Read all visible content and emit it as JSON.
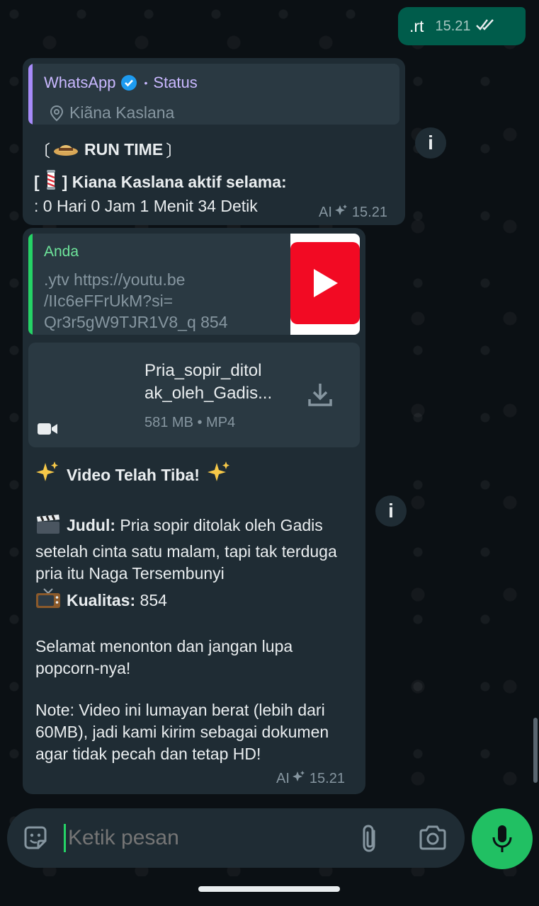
{
  "outgoing": {
    "text": ".rt",
    "time": "15.21",
    "status_icon": "double-check-icon"
  },
  "status_message": {
    "quote": {
      "sender": "WhatsApp",
      "separator": "•",
      "type": "Status",
      "location": "Kiãna Kaslana"
    },
    "line1_bracket_open": "〔",
    "line1_text": "RUN TIME",
    "line1_bracket_close": "〕",
    "line2_prefix": "[",
    "line2_suffix": "] Kiana Kaslana aktif selama:",
    "line3": ": 0 Hari 0 Jam 1 Menit 34 Detik",
    "ai_label": "AI",
    "time": "15.21"
  },
  "video_message": {
    "quote": {
      "sender": "Anda",
      "text_line1": ".ytv https://youtu.be",
      "text_line2": "/IIc6eFFrUkM?si=",
      "text_line3": "Qr3r5gW9TJR1V8_q 854"
    },
    "document": {
      "name_line1": "Pria_sopir_ditol",
      "name_line2": "ak_oleh_Gadis...",
      "size": "581 MB • MP4"
    },
    "headline": "Video Telah Tiba!",
    "judul_label": "Judul:",
    "judul_value": "Pria sopir ditolak oleh Gadis setelah cinta satu malam, tapi tak terduga pria itu Naga Tersembunyi",
    "kualitas_label": "Kualitas:",
    "kualitas_value": "854",
    "para1": "Selamat menonton dan jangan lupa popcorn-nya!",
    "para2": "Note: Video ini lumayan berat (lebih dari 60MB), jadi kami kirim sebagai dokumen agar tidak pecah dan tetap HD!",
    "ai_label": "AI",
    "time": "15.21"
  },
  "info_glyph": "i",
  "composer": {
    "placeholder": "Ketik pesan"
  },
  "colors": {
    "accent": "#25d366",
    "outgoing_bubble": "#005c4b",
    "incoming_bubble": "#1f2c34",
    "youtube_red": "#f20a23"
  }
}
